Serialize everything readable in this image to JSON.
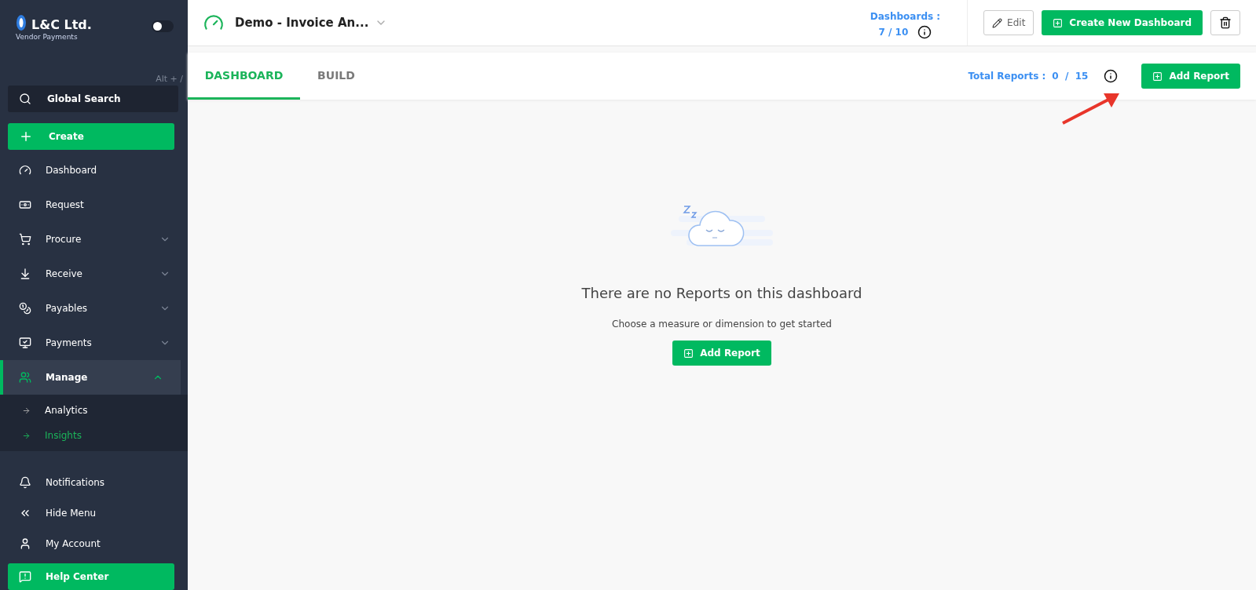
{
  "sidebar": {
    "brand": "L&C Ltd.",
    "subtitle": "Vendor Payments",
    "theme_toggle": {
      "on": false
    },
    "shortcut": "Alt + /",
    "search": {
      "label": "Global Search"
    },
    "create_button": "Create",
    "items": [
      {
        "label": "Dashboard",
        "selected": false
      },
      {
        "label": "Request",
        "selected": false
      },
      {
        "label": "Procure",
        "selected": false,
        "expanded": false
      },
      {
        "label": "Receive",
        "selected": false,
        "expanded": false
      },
      {
        "label": "Payables",
        "selected": false,
        "expanded": false
      },
      {
        "label": "Payments",
        "selected": false,
        "expanded": false
      },
      {
        "label": "Manage",
        "selected": true,
        "expanded": true,
        "children": [
          {
            "label": "Analytics",
            "selected": false
          },
          {
            "label": "Insights",
            "selected": true
          }
        ]
      }
    ],
    "bottom_items": [
      {
        "label": "Notifications"
      },
      {
        "label": "Hide Menu"
      },
      {
        "label": "My Account"
      }
    ],
    "help_button": "Help Center"
  },
  "header": {
    "dashboard_name": "Demo - Invoice An...",
    "dashboards_label": "Dashboards :",
    "dashboards_count": "7 / 10",
    "edit_button": "Edit",
    "create_button": "Create New Dashboard"
  },
  "tabs": [
    {
      "label": "DASHBOARD",
      "selected": true
    },
    {
      "label": "BUILD",
      "selected": false
    }
  ],
  "reports": {
    "label": "Total Reports :",
    "count": "0  /  15",
    "add_button": "Add Report"
  },
  "empty_state": {
    "title": "There are no Reports on this dashboard",
    "hint": "Choose a measure or dimension to get started",
    "button": "Add Report"
  }
}
